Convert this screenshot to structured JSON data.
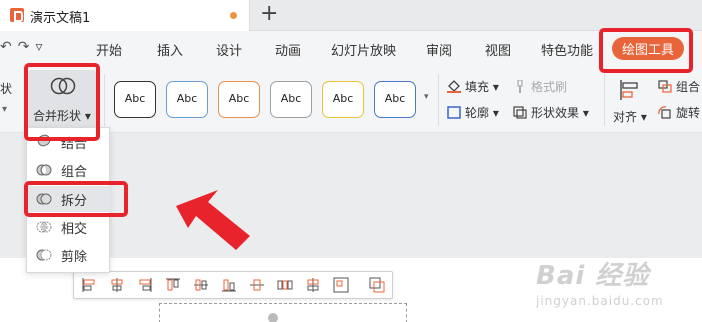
{
  "titlebar": {
    "doc_title": "演示文稿1",
    "new_tab": "+"
  },
  "menubar": {
    "undo": "↶",
    "redo": "↷",
    "more": "▿",
    "items": [
      "开始",
      "插入",
      "设计",
      "动画",
      "幻灯片放映",
      "审阅",
      "视图",
      "特色功能"
    ],
    "active_tab": "绘图工具"
  },
  "ribbon": {
    "left_stub": "状",
    "left_stub_arrow": "▾",
    "merge_shape_label": "合并形状 ▾",
    "style_samples": [
      {
        "label": "Abc",
        "color": "#333333"
      },
      {
        "label": "Abc",
        "color": "#6a9fd6"
      },
      {
        "label": "Abc",
        "color": "#e8914a"
      },
      {
        "label": "Abc",
        "color": "#a0a0a0"
      },
      {
        "label": "Abc",
        "color": "#e8c43a"
      },
      {
        "label": "Abc",
        "color": "#4a78c8"
      }
    ],
    "style_scroll": "▾",
    "fill_label": "填充 ▾",
    "format_brush_label": "格式刷",
    "outline_label": "轮廓 ▾",
    "shape_effect_label": "形状效果 ▾",
    "align_label": "对齐 ▾",
    "group_label": "组合",
    "rotate_label": "旋转"
  },
  "dropdown": {
    "items": [
      {
        "label": "结合",
        "icon": "union-icon"
      },
      {
        "label": "组合",
        "icon": "combine-icon"
      },
      {
        "label": "拆分",
        "icon": "fragment-icon"
      },
      {
        "label": "相交",
        "icon": "intersect-icon"
      },
      {
        "label": "剪除",
        "icon": "subtract-icon"
      }
    ]
  },
  "watermark": {
    "main": "Bai 经验",
    "sub": "jingyan.baidu.com"
  },
  "colors": {
    "accent": "#e8643a",
    "highlight_box": "#e8232c"
  }
}
